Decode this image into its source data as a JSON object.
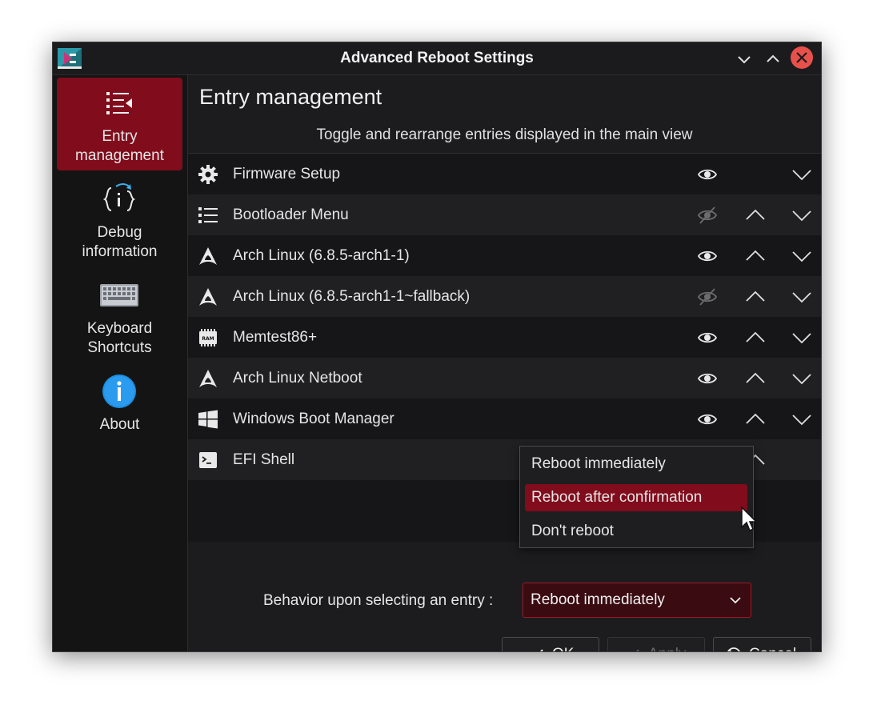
{
  "window": {
    "title": "Advanced Reboot Settings",
    "icons": [
      "app-icon",
      "minimize-icon",
      "maximize-icon",
      "close-icon"
    ]
  },
  "sidebar": {
    "items": [
      {
        "label_line1": "Entry",
        "label_line2": "management",
        "icon": "list-icon",
        "active": true
      },
      {
        "label_line1": "Debug",
        "label_line2": "information",
        "icon": "debug-info-icon"
      },
      {
        "label_line1": "Keyboard",
        "label_line2": "Shortcuts",
        "icon": "keyboard-icon"
      },
      {
        "label_line1": "About",
        "label_line2": "",
        "icon": "info-icon"
      }
    ]
  },
  "main": {
    "title": "Entry management",
    "subtitle": "Toggle and rearrange entries displayed in the main view",
    "entries": [
      {
        "label": "Firmware Setup",
        "icon": "gear-icon",
        "visible": true
      },
      {
        "label": "Bootloader Menu",
        "icon": "list-icon",
        "visible": false
      },
      {
        "label": "Arch Linux (6.8.5-arch1-1)",
        "icon": "arch-linux-icon",
        "visible": true
      },
      {
        "label": "Arch Linux (6.8.5-arch1-1~fallback)",
        "icon": "arch-linux-icon",
        "visible": false
      },
      {
        "label": "Memtest86+",
        "icon": "ram-chip-icon",
        "visible": true
      },
      {
        "label": "Arch Linux Netboot",
        "icon": "arch-linux-icon",
        "visible": true
      },
      {
        "label": "Windows Boot Manager",
        "icon": "windows-icon",
        "visible": true
      },
      {
        "label": "EFI Shell",
        "icon": "terminal-icon",
        "visible": true
      }
    ]
  },
  "behavior": {
    "label": "Behavior upon selecting an entry :",
    "selected": "Reboot immediately",
    "options": [
      "Reboot immediately",
      "Reboot after confirmation",
      "Don't reboot"
    ],
    "highlighted": "Reboot after confirmation"
  },
  "buttons": {
    "ok": "OK",
    "apply": "Apply",
    "cancel": "Cancel"
  },
  "colors": {
    "accent": "#800c1c",
    "combo_bg": "#3a0b11",
    "close": "#e8504b",
    "background": "#1c1c1e"
  }
}
